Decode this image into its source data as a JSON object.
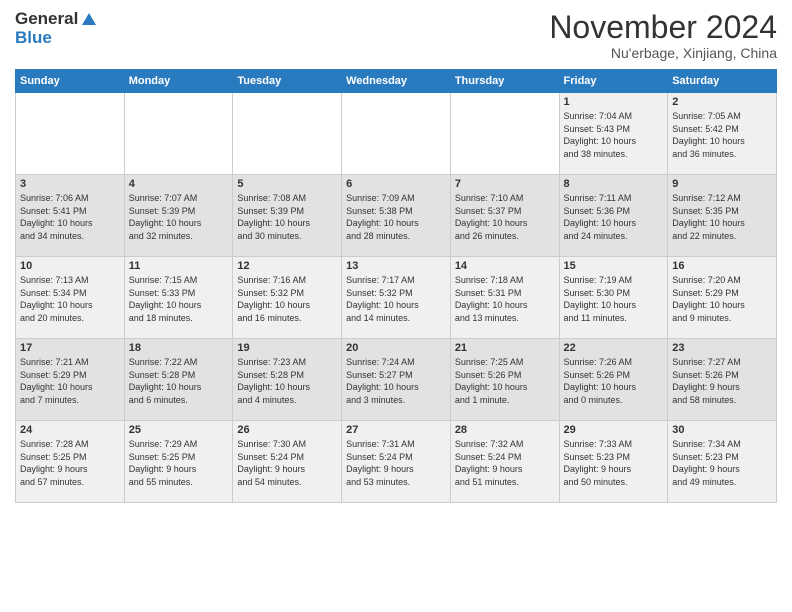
{
  "header": {
    "logo_line1": "General",
    "logo_line2": "Blue",
    "title": "November 2024",
    "subtitle": "Nu'erbage, Xinjiang, China"
  },
  "weekdays": [
    "Sunday",
    "Monday",
    "Tuesday",
    "Wednesday",
    "Thursday",
    "Friday",
    "Saturday"
  ],
  "weeks": [
    [
      {
        "day": "",
        "info": ""
      },
      {
        "day": "",
        "info": ""
      },
      {
        "day": "",
        "info": ""
      },
      {
        "day": "",
        "info": ""
      },
      {
        "day": "",
        "info": ""
      },
      {
        "day": "1",
        "info": "Sunrise: 7:04 AM\nSunset: 5:43 PM\nDaylight: 10 hours\nand 38 minutes."
      },
      {
        "day": "2",
        "info": "Sunrise: 7:05 AM\nSunset: 5:42 PM\nDaylight: 10 hours\nand 36 minutes."
      }
    ],
    [
      {
        "day": "3",
        "info": "Sunrise: 7:06 AM\nSunset: 5:41 PM\nDaylight: 10 hours\nand 34 minutes."
      },
      {
        "day": "4",
        "info": "Sunrise: 7:07 AM\nSunset: 5:39 PM\nDaylight: 10 hours\nand 32 minutes."
      },
      {
        "day": "5",
        "info": "Sunrise: 7:08 AM\nSunset: 5:39 PM\nDaylight: 10 hours\nand 30 minutes."
      },
      {
        "day": "6",
        "info": "Sunrise: 7:09 AM\nSunset: 5:38 PM\nDaylight: 10 hours\nand 28 minutes."
      },
      {
        "day": "7",
        "info": "Sunrise: 7:10 AM\nSunset: 5:37 PM\nDaylight: 10 hours\nand 26 minutes."
      },
      {
        "day": "8",
        "info": "Sunrise: 7:11 AM\nSunset: 5:36 PM\nDaylight: 10 hours\nand 24 minutes."
      },
      {
        "day": "9",
        "info": "Sunrise: 7:12 AM\nSunset: 5:35 PM\nDaylight: 10 hours\nand 22 minutes."
      }
    ],
    [
      {
        "day": "10",
        "info": "Sunrise: 7:13 AM\nSunset: 5:34 PM\nDaylight: 10 hours\nand 20 minutes."
      },
      {
        "day": "11",
        "info": "Sunrise: 7:15 AM\nSunset: 5:33 PM\nDaylight: 10 hours\nand 18 minutes."
      },
      {
        "day": "12",
        "info": "Sunrise: 7:16 AM\nSunset: 5:32 PM\nDaylight: 10 hours\nand 16 minutes."
      },
      {
        "day": "13",
        "info": "Sunrise: 7:17 AM\nSunset: 5:32 PM\nDaylight: 10 hours\nand 14 minutes."
      },
      {
        "day": "14",
        "info": "Sunrise: 7:18 AM\nSunset: 5:31 PM\nDaylight: 10 hours\nand 13 minutes."
      },
      {
        "day": "15",
        "info": "Sunrise: 7:19 AM\nSunset: 5:30 PM\nDaylight: 10 hours\nand 11 minutes."
      },
      {
        "day": "16",
        "info": "Sunrise: 7:20 AM\nSunset: 5:29 PM\nDaylight: 10 hours\nand 9 minutes."
      }
    ],
    [
      {
        "day": "17",
        "info": "Sunrise: 7:21 AM\nSunset: 5:29 PM\nDaylight: 10 hours\nand 7 minutes."
      },
      {
        "day": "18",
        "info": "Sunrise: 7:22 AM\nSunset: 5:28 PM\nDaylight: 10 hours\nand 6 minutes."
      },
      {
        "day": "19",
        "info": "Sunrise: 7:23 AM\nSunset: 5:28 PM\nDaylight: 10 hours\nand 4 minutes."
      },
      {
        "day": "20",
        "info": "Sunrise: 7:24 AM\nSunset: 5:27 PM\nDaylight: 10 hours\nand 3 minutes."
      },
      {
        "day": "21",
        "info": "Sunrise: 7:25 AM\nSunset: 5:26 PM\nDaylight: 10 hours\nand 1 minute."
      },
      {
        "day": "22",
        "info": "Sunrise: 7:26 AM\nSunset: 5:26 PM\nDaylight: 10 hours\nand 0 minutes."
      },
      {
        "day": "23",
        "info": "Sunrise: 7:27 AM\nSunset: 5:26 PM\nDaylight: 9 hours\nand 58 minutes."
      }
    ],
    [
      {
        "day": "24",
        "info": "Sunrise: 7:28 AM\nSunset: 5:25 PM\nDaylight: 9 hours\nand 57 minutes."
      },
      {
        "day": "25",
        "info": "Sunrise: 7:29 AM\nSunset: 5:25 PM\nDaylight: 9 hours\nand 55 minutes."
      },
      {
        "day": "26",
        "info": "Sunrise: 7:30 AM\nSunset: 5:24 PM\nDaylight: 9 hours\nand 54 minutes."
      },
      {
        "day": "27",
        "info": "Sunrise: 7:31 AM\nSunset: 5:24 PM\nDaylight: 9 hours\nand 53 minutes."
      },
      {
        "day": "28",
        "info": "Sunrise: 7:32 AM\nSunset: 5:24 PM\nDaylight: 9 hours\nand 51 minutes."
      },
      {
        "day": "29",
        "info": "Sunrise: 7:33 AM\nSunset: 5:23 PM\nDaylight: 9 hours\nand 50 minutes."
      },
      {
        "day": "30",
        "info": "Sunrise: 7:34 AM\nSunset: 5:23 PM\nDaylight: 9 hours\nand 49 minutes."
      }
    ]
  ]
}
